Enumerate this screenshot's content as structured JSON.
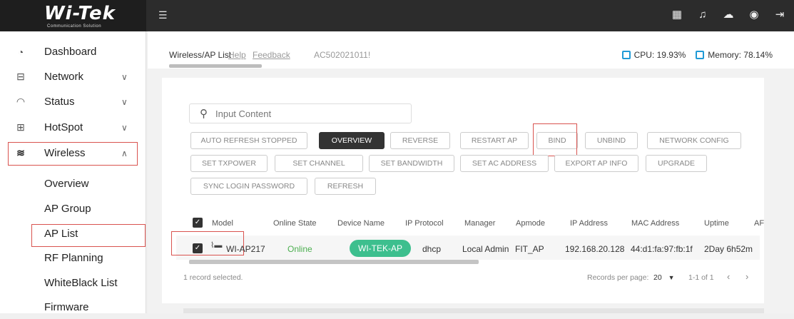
{
  "brand": {
    "logo": "Wi-Tek",
    "tagline": "Communication Solution"
  },
  "topbar": {
    "menu_icon": "menu-icon",
    "icons": [
      "qr-code-icon",
      "bell-icon",
      "cloud-icon",
      "globe-icon",
      "logout-icon"
    ]
  },
  "sidebar": {
    "items": [
      {
        "label": "Dashboard",
        "icon": "dashboard-icon"
      },
      {
        "label": "Network",
        "icon": "network-icon"
      },
      {
        "label": "Status",
        "icon": "status-icon"
      },
      {
        "label": "HotSpot",
        "icon": "hotspot-icon"
      },
      {
        "label": "Wireless",
        "icon": "wifi-icon"
      }
    ],
    "wireless_sub": [
      "Overview",
      "AP Group",
      "AP List",
      "RF Planning",
      "WhiteBlack List",
      "Firmware"
    ]
  },
  "breadcrumb": {
    "current": "Wireless/AP List",
    "help": "Help",
    "feedback": "Feedback",
    "ac_id": "AC502021011!"
  },
  "stats": {
    "cpu": "CPU: 19.93%",
    "memory": "Memory: 78.14%"
  },
  "search": {
    "placeholder": "Input Content"
  },
  "buttons": {
    "row1": [
      "AUTO REFRESH STOPPED",
      "OVERVIEW",
      "REVERSE",
      "RESTART AP",
      "BIND",
      "UNBIND",
      "NETWORK CONFIG"
    ],
    "row2": [
      "SET TXPOWER",
      "SET CHANNEL",
      "SET BANDWIDTH",
      "SET AC ADDRESS",
      "EXPORT AP INFO",
      "UPGRADE"
    ],
    "row3": [
      "SYNC LOGIN PASSWORD",
      "REFRESH"
    ]
  },
  "table": {
    "headers": [
      "Model",
      "Online State",
      "Device Name",
      "IP Protocol",
      "Manager",
      "Apmode",
      "IP Address",
      "MAC Address",
      "Uptime",
      "AF"
    ],
    "row": {
      "model": "WI-AP217",
      "online_state": "Online",
      "device_name": "WI-TEK-AP",
      "ip_protocol": "dhcp",
      "manager": "Local Admin",
      "apmode": "FIT_AP",
      "ip_address": "192.168.20.128",
      "mac_address": "44:d1:fa:97:fb:1f",
      "uptime": "2Day 6h52m"
    }
  },
  "footer": {
    "selected": "1 record selected.",
    "per_page_label": "Records per page:",
    "per_page": "20",
    "range": "1-1 of 1"
  },
  "colors": {
    "topbar": "#2c2c2c",
    "accent": "#1f9ad6",
    "online": "#4caf50",
    "pill": "#3dbf8e",
    "highlight": "#d9534f"
  }
}
